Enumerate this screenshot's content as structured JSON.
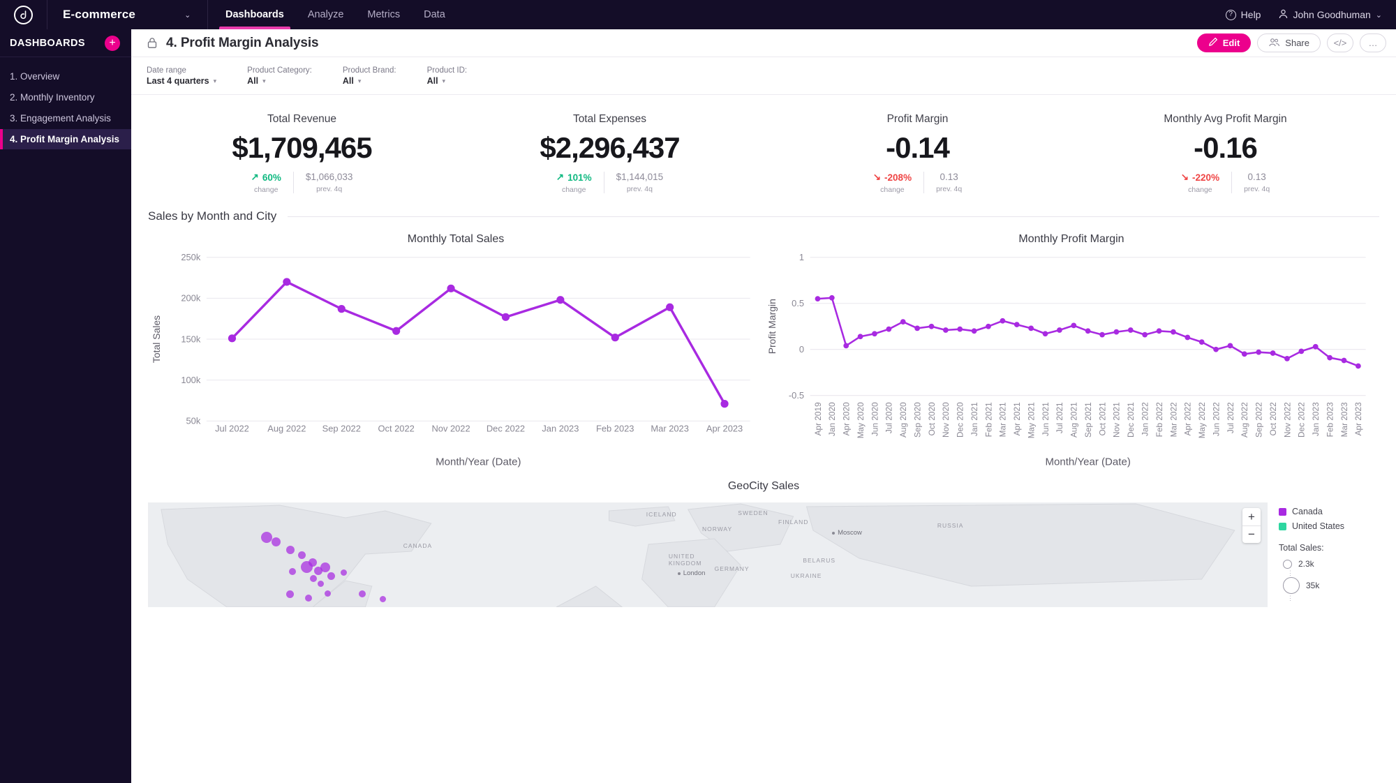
{
  "topnav": {
    "logo": "logo-icon",
    "brand": "E-commerce",
    "brand_chevron": "⌄",
    "tabs": [
      {
        "label": "Dashboards",
        "active": true
      },
      {
        "label": "Analyze",
        "active": false
      },
      {
        "label": "Metrics",
        "active": false
      },
      {
        "label": "Data",
        "active": false
      }
    ],
    "help": "Help",
    "user": "John Goodhuman",
    "user_chevron": "⌄"
  },
  "sidebar": {
    "title": "DASHBOARDS",
    "add_label": "+",
    "items": [
      {
        "label": "1. Overview",
        "active": false
      },
      {
        "label": "2. Monthly Inventory",
        "active": false
      },
      {
        "label": "3. Engagement Analysis",
        "active": false
      },
      {
        "label": "4. Profit Margin Analysis",
        "active": true
      }
    ]
  },
  "header": {
    "title": "4. Profit Margin Analysis",
    "edit_label": "Edit",
    "share_label": "Share",
    "embed_label": "</>",
    "more_label": "…"
  },
  "filters": [
    {
      "label": "Date range",
      "value": "Last 4 quarters"
    },
    {
      "label": "Product Category:",
      "value": "All"
    },
    {
      "label": "Product Brand:",
      "value": "All"
    },
    {
      "label": "Product ID:",
      "value": "All"
    }
  ],
  "kpis": [
    {
      "label": "Total Revenue",
      "value": "$1,709,465",
      "delta": "60%",
      "delta_dir": "up",
      "delta_arrow": "↗",
      "prev": "$1,066,033",
      "change_caption": "change",
      "prev_caption": "prev. 4q"
    },
    {
      "label": "Total Expenses",
      "value": "$2,296,437",
      "delta": "101%",
      "delta_dir": "up",
      "delta_arrow": "↗",
      "prev": "$1,144,015",
      "change_caption": "change",
      "prev_caption": "prev. 4q"
    },
    {
      "label": "Profit Margin",
      "value": "-0.14",
      "delta": "-208%",
      "delta_dir": "down",
      "delta_arrow": "↘",
      "prev": "0.13",
      "change_caption": "change",
      "prev_caption": "prev. 4q"
    },
    {
      "label": "Monthly Avg Profit Margin",
      "value": "-0.16",
      "delta": "-220%",
      "delta_dir": "down",
      "delta_arrow": "↘",
      "prev": "0.13",
      "change_caption": "change",
      "prev_caption": "prev. 4q"
    }
  ],
  "section": {
    "title": "Sales by Month and City"
  },
  "map": {
    "title": "GeoCity Sales",
    "zoom_in": "+",
    "zoom_out": "−",
    "legend_series": [
      {
        "label": "Canada",
        "color": "#a82ae1"
      },
      {
        "label": "United States",
        "color": "#2ed6a0"
      }
    ],
    "size_legend_title": "Total Sales:",
    "size_legend": [
      {
        "label": "2.3k",
        "d": 13
      },
      {
        "label": "35k",
        "d": 24
      }
    ],
    "labels": [
      "ICELAND",
      "SWEDEN",
      "FINLAND",
      "NORWAY",
      "RUSSIA",
      "CANADA",
      "UNITED KINGDOM",
      "BELARUS",
      "GERMANY",
      "UKRAINE"
    ],
    "cities": [
      "Moscow",
      "London"
    ]
  },
  "chart_data": [
    {
      "type": "line",
      "title": "Monthly Total Sales",
      "xlabel": "Month/Year (Date)",
      "ylabel": "Total Sales",
      "ylim": [
        50000,
        250000
      ],
      "yticks": [
        50000,
        100000,
        150000,
        200000,
        250000
      ],
      "ytick_labels": [
        "50k",
        "100k",
        "150k",
        "200k",
        "250k"
      ],
      "grid": true,
      "legend": "none",
      "color": "#a82ae1",
      "categories": [
        "Jul 2022",
        "Aug 2022",
        "Sep 2022",
        "Oct 2022",
        "Nov 2022",
        "Dec 2022",
        "Jan 2023",
        "Feb 2023",
        "Mar 2023",
        "Apr 2023"
      ],
      "values": [
        151000,
        220000,
        187000,
        160000,
        212000,
        177000,
        198000,
        152000,
        189000,
        71000
      ]
    },
    {
      "type": "line",
      "title": "Monthly Profit Margin",
      "xlabel": "Month/Year (Date)",
      "ylabel": "Profit Margin",
      "ylim": [
        -0.5,
        1
      ],
      "yticks": [
        -0.5,
        0,
        0.5,
        1
      ],
      "ytick_labels": [
        "-0.5",
        "0",
        "0.5",
        "1"
      ],
      "grid": true,
      "legend": "none",
      "color": "#a82ae1",
      "categories": [
        "Apr 2019",
        "Jan 2020",
        "Apr 2020",
        "May 2020",
        "Jun 2020",
        "Jul 2020",
        "Aug 2020",
        "Sep 2020",
        "Oct 2020",
        "Nov 2020",
        "Dec 2020",
        "Jan 2021",
        "Feb 2021",
        "Mar 2021",
        "Apr 2021",
        "May 2021",
        "Jun 2021",
        "Jul 2021",
        "Aug 2021",
        "Sep 2021",
        "Oct 2021",
        "Nov 2021",
        "Dec 2021",
        "Jan 2022",
        "Feb 2022",
        "Mar 2022",
        "Apr 2022",
        "May 2022",
        "Jun 2022",
        "Jul 2022",
        "Aug 2022",
        "Sep 2022",
        "Oct 2022",
        "Nov 2022",
        "Dec 2022",
        "Jan 2023",
        "Feb 2023",
        "Mar 2023",
        "Apr 2023"
      ],
      "values": [
        0.55,
        0.56,
        0.04,
        0.14,
        0.17,
        0.22,
        0.3,
        0.23,
        0.25,
        0.21,
        0.22,
        0.2,
        0.25,
        0.31,
        0.27,
        0.23,
        0.17,
        0.21,
        0.26,
        0.2,
        0.16,
        0.19,
        0.21,
        0.16,
        0.2,
        0.19,
        0.13,
        0.08,
        0.0,
        0.04,
        -0.05,
        -0.03,
        -0.04,
        -0.1,
        -0.02,
        0.03,
        -0.09,
        -0.12,
        -0.18
      ]
    }
  ]
}
